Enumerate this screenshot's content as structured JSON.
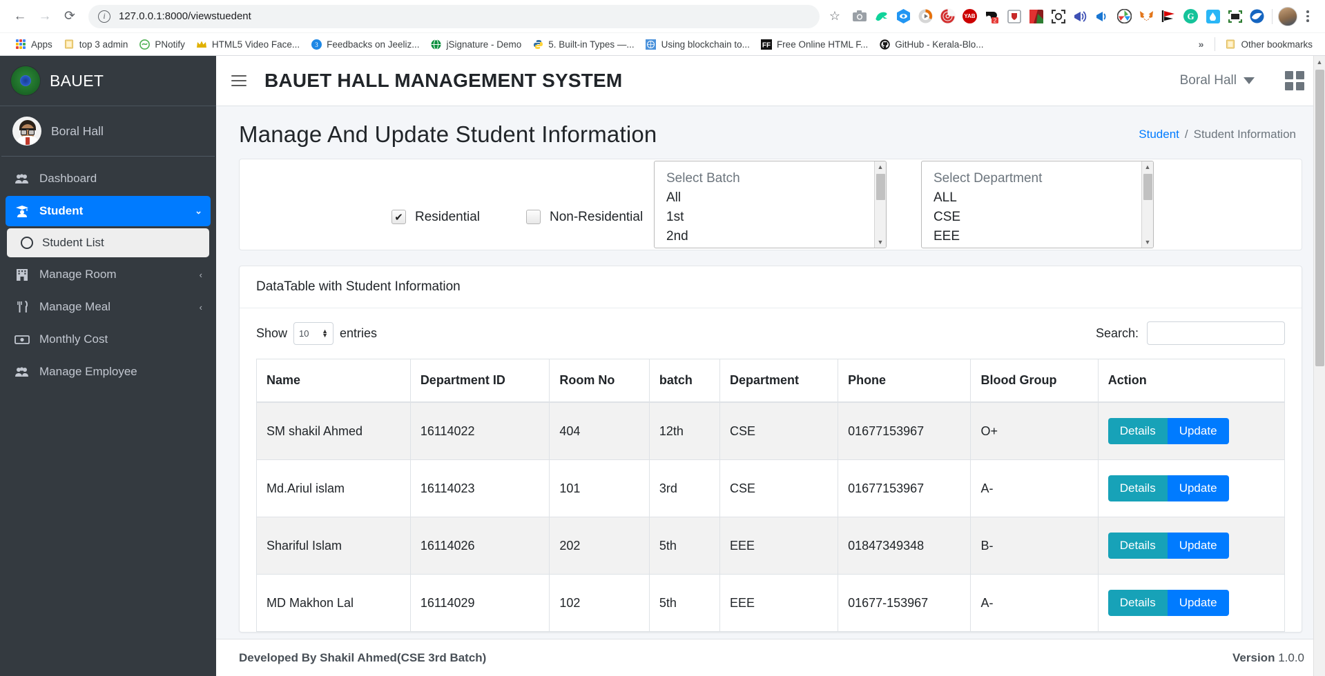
{
  "browser": {
    "back_icon": "←",
    "forward_icon": "→",
    "reload_icon": "⟳",
    "site_info_icon": "site-info-icon",
    "url": "127.0.0.1:8000/viewstuedent",
    "star_icon": "☆",
    "extensions": [
      {
        "name": "camera-extension-icon",
        "glyph": "📷",
        "color": "#9aa0a6"
      },
      {
        "name": "dinosaur-extension-icon",
        "glyph": "🦖",
        "color": "#00c08b"
      },
      {
        "name": "eye-extension-icon",
        "glyph": "◉",
        "color": "#2196f3"
      },
      {
        "name": "play-extension-icon",
        "glyph": "▶",
        "color": "#e8710a"
      },
      {
        "name": "target-extension-icon",
        "glyph": "◎",
        "color": "#d32f2f"
      },
      {
        "name": "yab-extension-icon",
        "glyph": "YAB",
        "color": "#cc0000"
      },
      {
        "name": "badge-extension-icon",
        "glyph": "2",
        "color": "#111111"
      },
      {
        "name": "shield-extension-icon",
        "glyph": "🛡",
        "color": "#c62828"
      },
      {
        "name": "redmark-extension-icon",
        "glyph": "◤",
        "color": "#b71c1c"
      },
      {
        "name": "capture-extension-icon",
        "glyph": "⛶",
        "color": "#333333"
      },
      {
        "name": "megaphone-extension-icon",
        "glyph": "📣",
        "color": "#3f51b5"
      },
      {
        "name": "speaker-extension-icon",
        "glyph": "🔊",
        "color": "#1976d2"
      },
      {
        "name": "aperture-extension-icon",
        "glyph": "◍",
        "color": "#444444"
      },
      {
        "name": "metamask-extension-icon",
        "glyph": "🦊",
        "color": "#e2761b"
      },
      {
        "name": "flag-extension-icon",
        "glyph": "⚑",
        "color": "#d50000"
      },
      {
        "name": "grammarly-extension-icon",
        "glyph": "G",
        "color": "#15c39a"
      },
      {
        "name": "water-extension-icon",
        "glyph": "💧",
        "color": "#29b6f6"
      },
      {
        "name": "frame-extension-icon",
        "glyph": "⛶",
        "color": "#2e7d32"
      },
      {
        "name": "bird-extension-icon",
        "glyph": "🕊",
        "color": "#1565c0"
      }
    ],
    "profile_avatar": "profile-avatar",
    "menu_icon": "⋮",
    "bookmarks": [
      {
        "label": "Apps",
        "icon": "apps-grid-icon"
      },
      {
        "label": "top 3 admin",
        "icon": "folder-icon"
      },
      {
        "label": "PNotify",
        "icon": "pnotify-icon"
      },
      {
        "label": "HTML5 Video Face...",
        "icon": "crown-icon"
      },
      {
        "label": "Feedbacks on Jeeliz...",
        "icon": "jeeliz-icon"
      },
      {
        "label": "jSignature - Demo",
        "icon": "globe-icon"
      },
      {
        "label": "5. Built-in Types —...",
        "icon": "python-icon"
      },
      {
        "label": "Using blockchain to...",
        "icon": "un-icon"
      },
      {
        "label": "Free Online HTML F...",
        "icon": "ff-icon"
      },
      {
        "label": "GitHub - Kerala-Blo...",
        "icon": "github-icon"
      }
    ],
    "overflow_label": "»",
    "other_bookmarks": {
      "label": "Other bookmarks",
      "icon": "folder-icon"
    }
  },
  "sidebar": {
    "brand": {
      "label": "BAUET",
      "logo_icon": "bauet-crest-icon"
    },
    "user": {
      "name": "Boral Hall",
      "avatar_icon": "user-avatar"
    },
    "items": [
      {
        "label": "Dashboard",
        "icon": "users-icon",
        "arrow": "",
        "active": false
      },
      {
        "label": "Student",
        "icon": "graduation-user-icon",
        "arrow": "⌄",
        "active": true
      },
      {
        "label": "Manage Room",
        "icon": "building-icon",
        "arrow": "‹",
        "active": false
      },
      {
        "label": "Manage Meal",
        "icon": "cutlery-icon",
        "arrow": "‹",
        "active": false
      },
      {
        "label": "Monthly Cost",
        "icon": "money-bill-icon",
        "arrow": "",
        "active": false
      },
      {
        "label": "Manage Employee",
        "icon": "users-icon",
        "arrow": "",
        "active": false
      }
    ],
    "submenu": {
      "label": "Student List",
      "icon": "circle-icon"
    }
  },
  "topnav": {
    "menu_icon": "hamburger-icon",
    "title": "BAUET HALL MANAGEMENT SYSTEM",
    "hall_label": "Boral Hall",
    "caret_icon": "chevron-down-icon",
    "grid_icon": "grid-icon"
  },
  "page": {
    "title": "Manage And Update Student Information",
    "breadcrumb": {
      "link": "Student",
      "separator": "/",
      "current": "Student Information"
    }
  },
  "filters": {
    "residential": {
      "label": "Residential",
      "checked": true,
      "check_glyph": "✔"
    },
    "non_residential": {
      "label": "Non-Residential",
      "checked": false,
      "check_glyph": ""
    },
    "batch_select": {
      "name": "Select Batch",
      "options": [
        "Select Batch",
        "All",
        "1st",
        "2nd"
      ]
    },
    "department_select": {
      "name": "Select Department",
      "options": [
        "Select Department",
        "ALL",
        "CSE",
        "EEE"
      ]
    }
  },
  "datatable": {
    "card_title": "DataTable with Student Information",
    "show_label": "Show",
    "entries_label": "entries",
    "page_length": "10",
    "search_label": "Search:",
    "search_value": "",
    "search_placeholder": "",
    "columns": [
      "Name",
      "Department ID",
      "Room No",
      "batch",
      "Department",
      "Phone",
      "Blood Group",
      "Action"
    ],
    "action_labels": {
      "details": "Details",
      "update": "Update"
    },
    "rows": [
      {
        "name": "SM shakil Ahmed",
        "department_id": "16114022",
        "room_no": "404",
        "batch": "12th",
        "department": "CSE",
        "phone": "01677153967",
        "blood_group": "O+"
      },
      {
        "name": "Md.Ariul islam",
        "department_id": "16114023",
        "room_no": "101",
        "batch": "3rd",
        "department": "CSE",
        "phone": "01677153967",
        "blood_group": "A-"
      },
      {
        "name": "Shariful Islam",
        "department_id": "16114026",
        "room_no": "202",
        "batch": "5th",
        "department": "EEE",
        "phone": "01847349348",
        "blood_group": "B-"
      },
      {
        "name": "MD Makhon Lal",
        "department_id": "16114029",
        "room_no": "102",
        "batch": "5th",
        "department": "EEE",
        "phone": "01677-153967",
        "blood_group": "A-"
      }
    ]
  },
  "footer": {
    "developed_by": "Developed By Shakil Ahmed(CSE 3rd Batch)",
    "version_label": "Version",
    "version_number": "1.0.0"
  },
  "colors": {
    "sidebar_bg": "#343a40",
    "accent_primary": "#007bff",
    "accent_teal": "#17a2b8",
    "link": "#007bff"
  }
}
